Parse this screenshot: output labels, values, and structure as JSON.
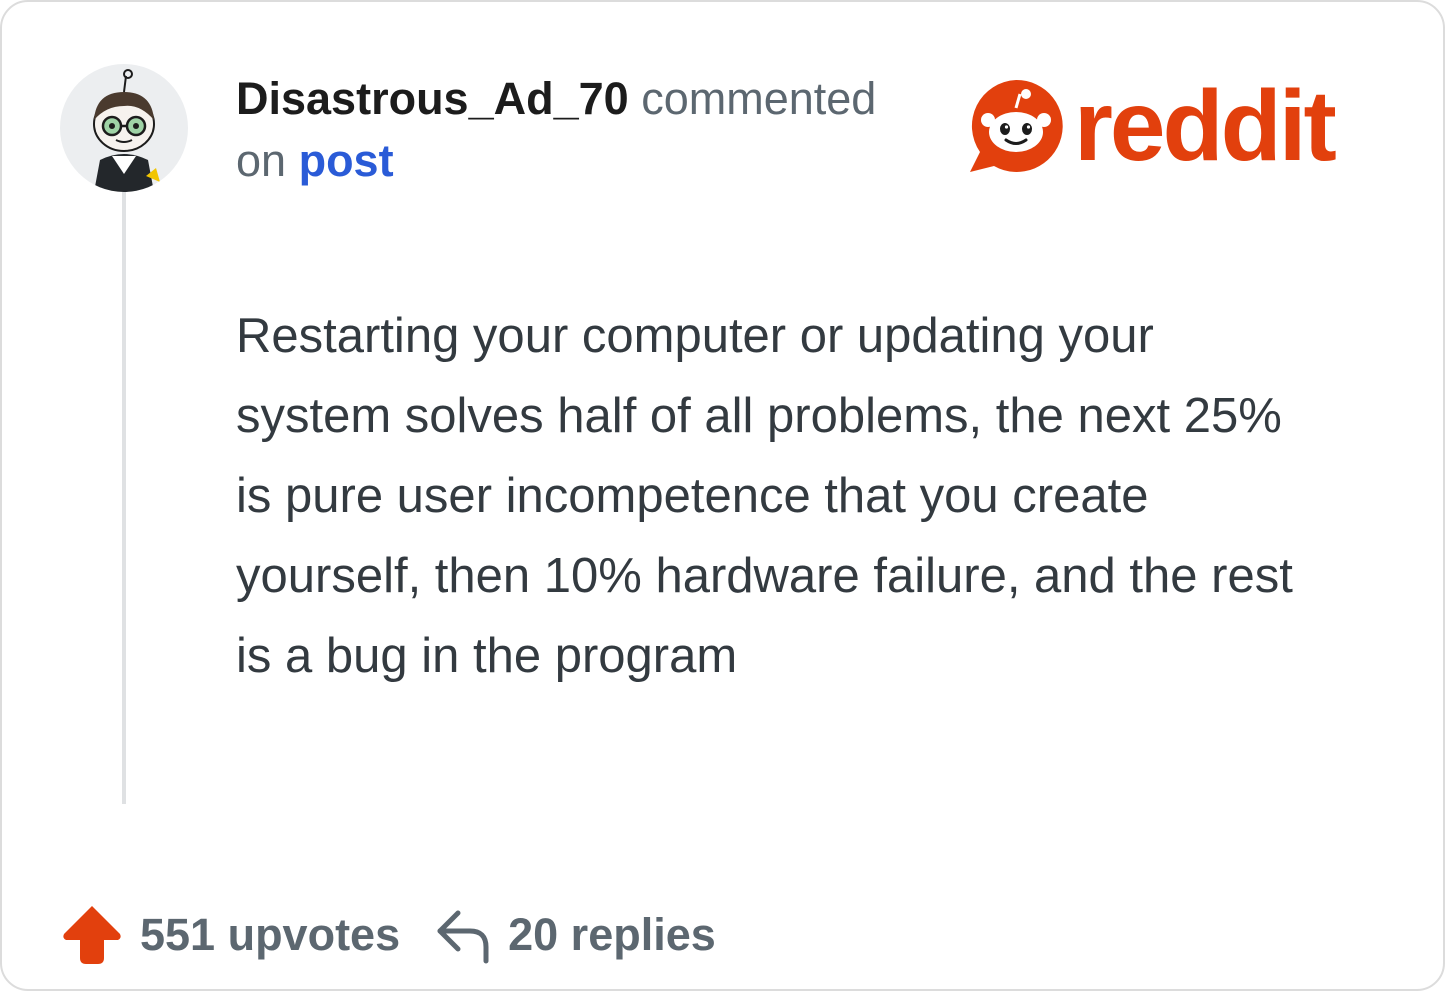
{
  "comment": {
    "username": "Disastrous_Ad_70",
    "action_text": "commented",
    "on_text": "on",
    "post_link": "post",
    "body": "Restarting your computer or updating your system solves half of all problems, the next 25% is pure user incompetence that you create yourself, then 10% hardware failure, and the rest is a bug in the program"
  },
  "logo": {
    "wordmark": "reddit",
    "color": "#e2400d"
  },
  "footer": {
    "upvotes_label": "551 upvotes",
    "replies_label": "20 replies",
    "upvote_color": "#e2400d"
  },
  "icons": {
    "avatar": "avatar-icon",
    "logo_mark": "reddit-snoo-icon",
    "upvote": "upvote-arrow-icon",
    "reply": "reply-arrow-icon"
  }
}
